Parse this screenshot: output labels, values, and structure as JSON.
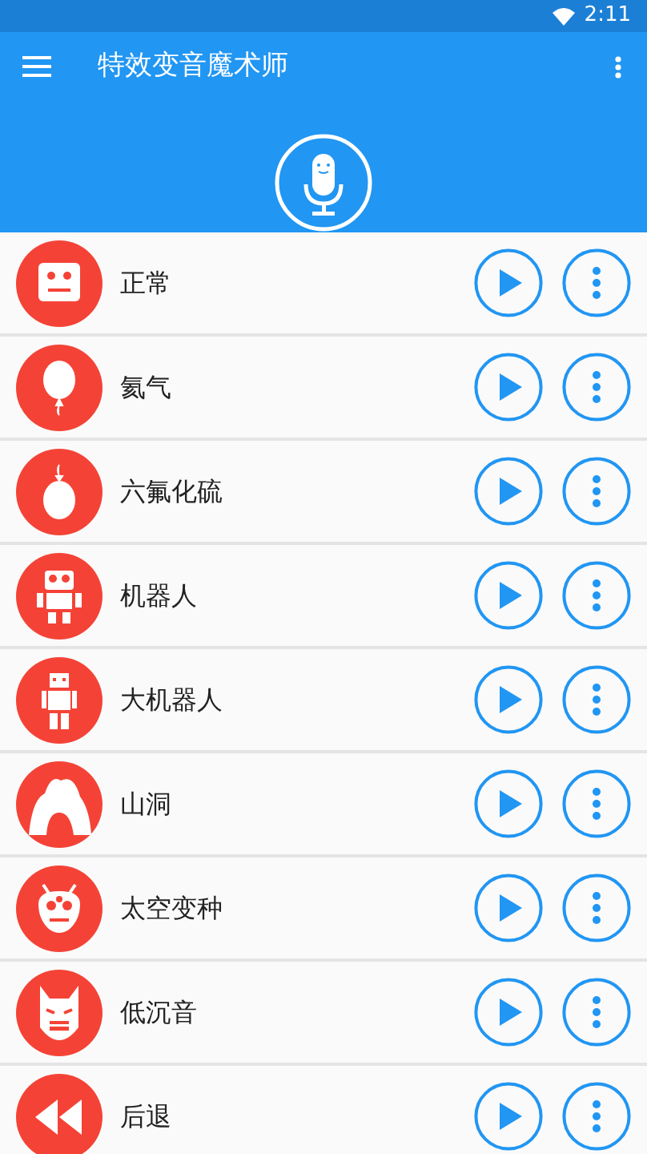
{
  "status_bar": {
    "time": "2:11"
  },
  "app_bar": {
    "title": "特效变音魔术师"
  },
  "effects": [
    {
      "name": "正常",
      "kind": "face"
    },
    {
      "name": "氦气",
      "kind": "balloon"
    },
    {
      "name": "六氟化硫",
      "kind": "heavy-balloon"
    },
    {
      "name": "机器人",
      "kind": "robot"
    },
    {
      "name": "大机器人",
      "kind": "tall-robot"
    },
    {
      "name": "山洞",
      "kind": "cave"
    },
    {
      "name": "太空变种",
      "kind": "alien"
    },
    {
      "name": "低沉音",
      "kind": "mask"
    },
    {
      "name": "后退",
      "kind": "rewind"
    }
  ]
}
